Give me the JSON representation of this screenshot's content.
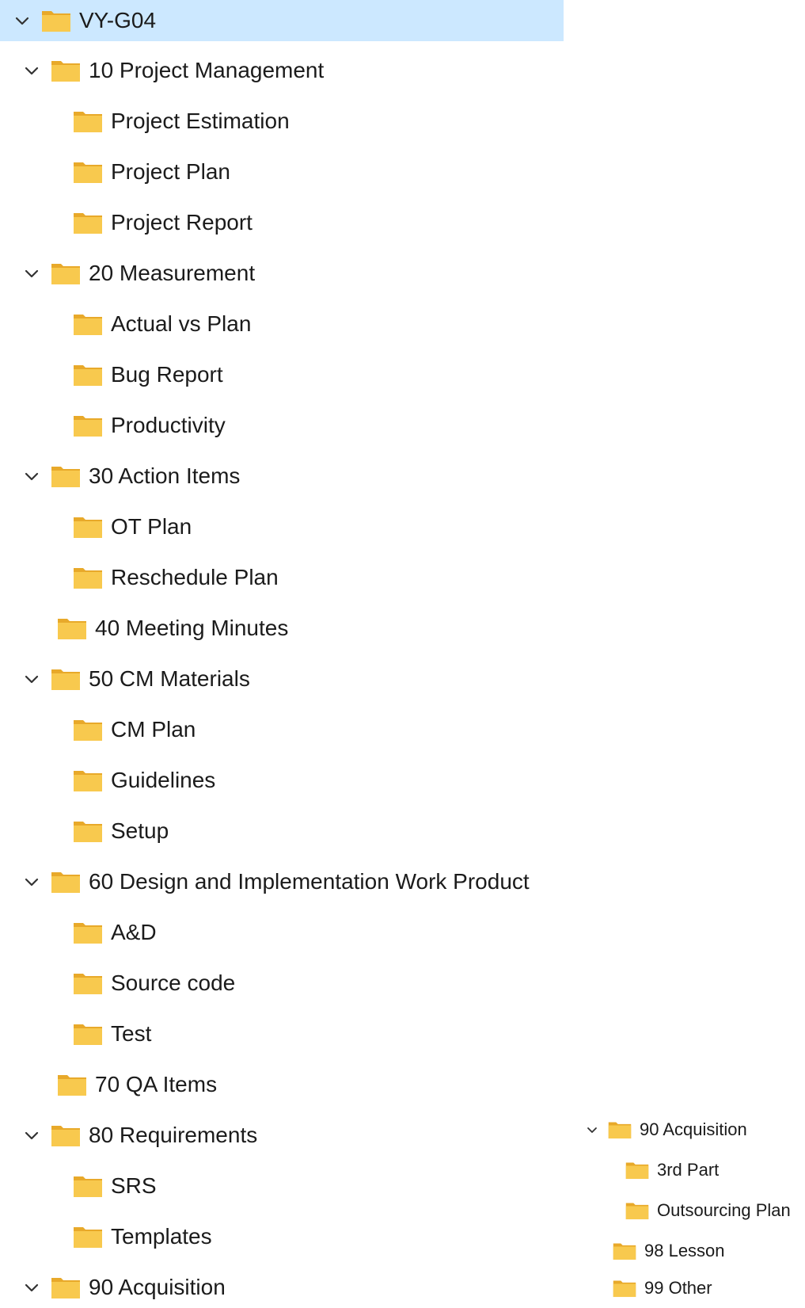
{
  "colors": {
    "selection": "#cce8ff",
    "folder_body": "#f8c94e",
    "folder_tab": "#e8a92a",
    "chevron": "#333333"
  },
  "tree": {
    "root": "VY-G04",
    "items": [
      {
        "label": "10 Project Management",
        "expanded": true,
        "icon": "folder-icon"
      },
      {
        "label": "Project Estimation",
        "icon": "folder-icon"
      },
      {
        "label": "Project Plan",
        "icon": "folder-icon"
      },
      {
        "label": "Project Report",
        "icon": "folder-icon"
      },
      {
        "label": "20 Measurement",
        "expanded": true,
        "icon": "folder-icon"
      },
      {
        "label": "Actual vs Plan",
        "icon": "folder-icon"
      },
      {
        "label": "Bug Report",
        "icon": "folder-icon"
      },
      {
        "label": "Productivity",
        "icon": "folder-icon"
      },
      {
        "label": "30 Action Items",
        "expanded": true,
        "icon": "folder-icon"
      },
      {
        "label": "OT Plan",
        "icon": "folder-icon"
      },
      {
        "label": "Reschedule Plan",
        "icon": "folder-icon"
      },
      {
        "label": "40 Meeting Minutes",
        "icon": "folder-icon"
      },
      {
        "label": "50 CM Materials",
        "expanded": true,
        "icon": "folder-icon"
      },
      {
        "label": "CM Plan",
        "icon": "folder-icon"
      },
      {
        "label": "Guidelines",
        "icon": "folder-icon"
      },
      {
        "label": "Setup",
        "icon": "folder-icon"
      },
      {
        "label": "60 Design and Implementation Work Product",
        "expanded": true,
        "icon": "folder-icon"
      },
      {
        "label": "A&D",
        "icon": "folder-icon"
      },
      {
        "label": "Source code",
        "icon": "folder-icon"
      },
      {
        "label": "Test",
        "icon": "folder-icon"
      },
      {
        "label": "70 QA Items",
        "icon": "folder-icon"
      },
      {
        "label": "80 Requirements",
        "expanded": true,
        "icon": "folder-icon"
      },
      {
        "label": "SRS",
        "icon": "folder-icon"
      },
      {
        "label": "Templates",
        "icon": "folder-icon"
      },
      {
        "label": "90 Acquisition",
        "expanded": true,
        "icon": "folder-icon"
      }
    ]
  },
  "inset_tree": {
    "items": [
      {
        "label": "90 Acquisition",
        "expanded": true,
        "icon": "folder-icon"
      },
      {
        "label": "3rd Part",
        "icon": "folder-icon"
      },
      {
        "label": "Outsourcing Plan",
        "icon": "folder-icon"
      },
      {
        "label": "98 Lesson",
        "icon": "folder-icon"
      },
      {
        "label": "99 Other",
        "icon": "folder-icon"
      }
    ]
  }
}
